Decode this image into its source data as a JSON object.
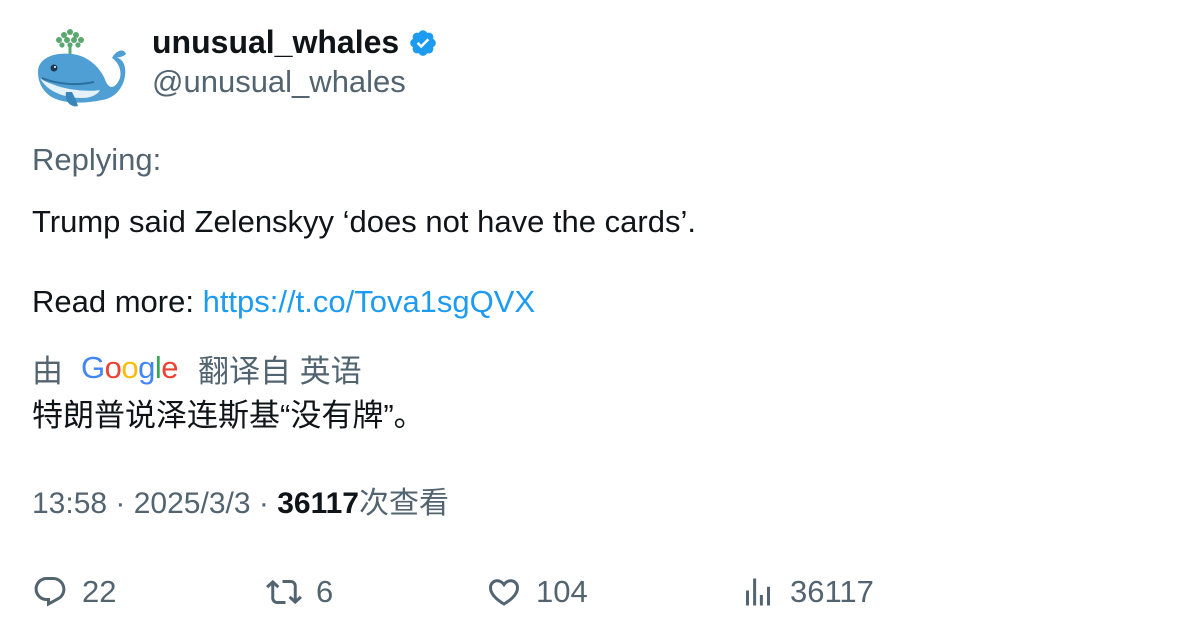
{
  "author": {
    "display_name": "unusual_whales",
    "handle": "@unusual_whales",
    "verified": true,
    "verified_color": "#1d9bf0"
  },
  "replying_label": "Replying:",
  "tweet": {
    "text": "Trump said Zelenskyy ‘does not have the cards’.",
    "read_more_label": "Read more: ",
    "link": "https://t.co/Tova1sgQVX",
    "link_color": "#1d9bf0"
  },
  "translation": {
    "by_label": "由",
    "provider_letters": [
      {
        "char": "G",
        "color": "#4285f4"
      },
      {
        "char": "o",
        "color": "#ea4335"
      },
      {
        "char": "o",
        "color": "#fbbc05"
      },
      {
        "char": "g",
        "color": "#4285f4"
      },
      {
        "char": "l",
        "color": "#34a853"
      },
      {
        "char": "e",
        "color": "#ea4335"
      }
    ],
    "from_label": "翻译自 英语",
    "text": "特朗普说泽连斯基“没有牌”。"
  },
  "meta": {
    "time": "13:58",
    "separator": " · ",
    "date": "2025/3/3",
    "views_count": "36117",
    "views_label": "次查看"
  },
  "actions": {
    "replies": "22",
    "retweets": "6",
    "likes": "104",
    "views": "36117"
  }
}
